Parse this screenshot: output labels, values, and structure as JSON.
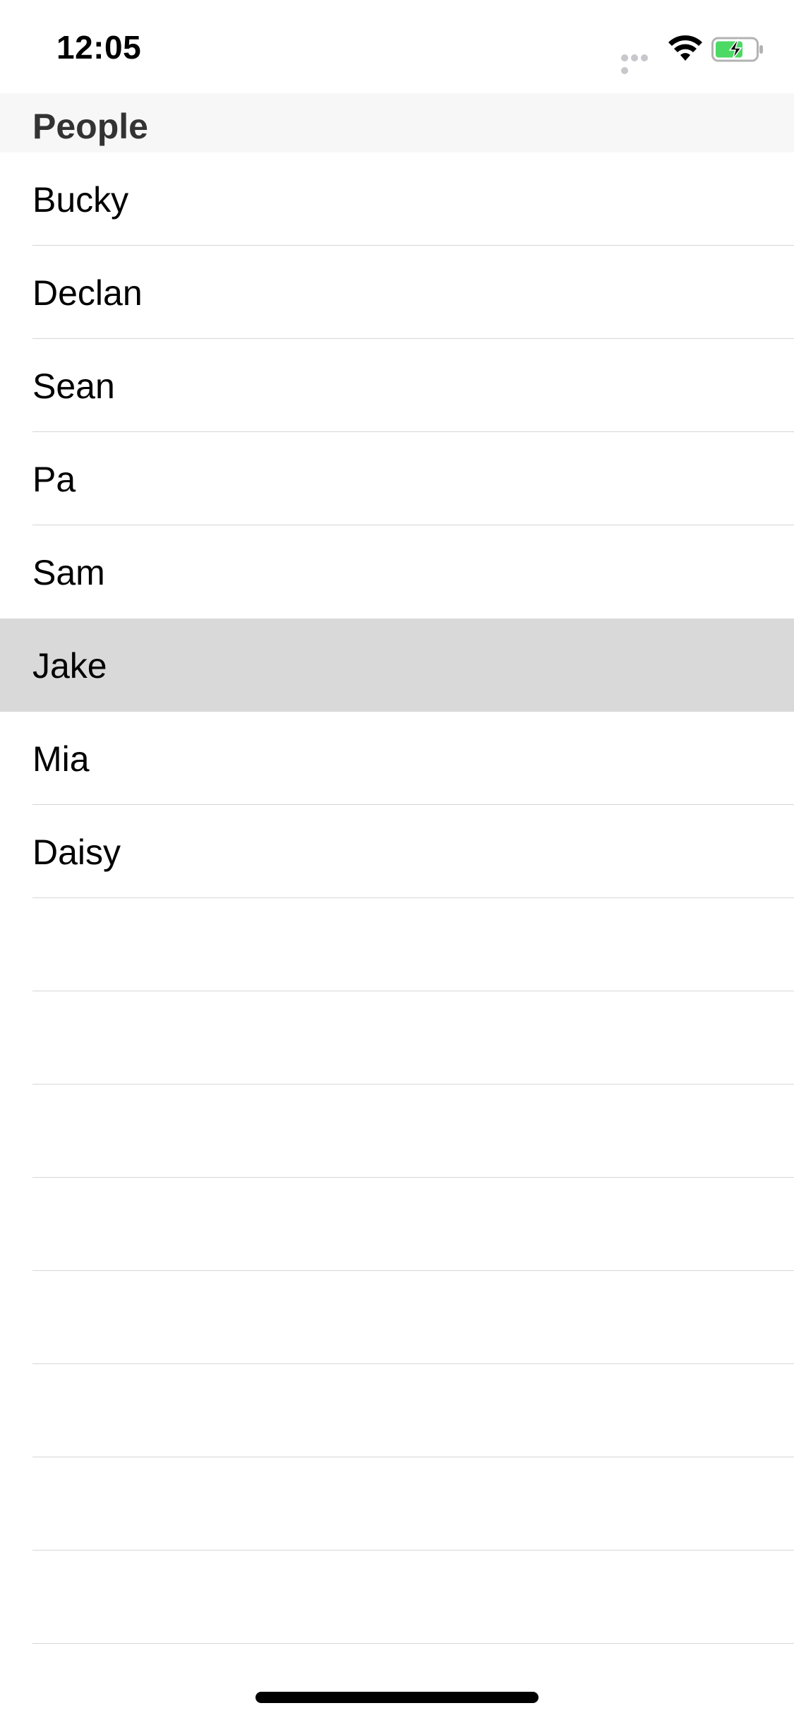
{
  "status_bar": {
    "time": "12:05",
    "icons": [
      "signal-dots-icon",
      "wifi-icon",
      "battery-charging-icon"
    ],
    "battery_color": "#4cd964"
  },
  "section": {
    "title": "People"
  },
  "list": {
    "items": [
      {
        "name": "Bucky",
        "selected": false
      },
      {
        "name": "Declan",
        "selected": false
      },
      {
        "name": "Sean",
        "selected": false
      },
      {
        "name": "Pa",
        "selected": false
      },
      {
        "name": "Sam",
        "selected": false
      },
      {
        "name": "Jake",
        "selected": true
      },
      {
        "name": "Mia",
        "selected": false
      },
      {
        "name": "Daisy",
        "selected": false
      }
    ],
    "empty_rows": 8
  },
  "colors": {
    "section_header_bg": "#f7f7f7",
    "selected_row_bg": "#d9d9d9",
    "separator": "#d6d6d9"
  }
}
